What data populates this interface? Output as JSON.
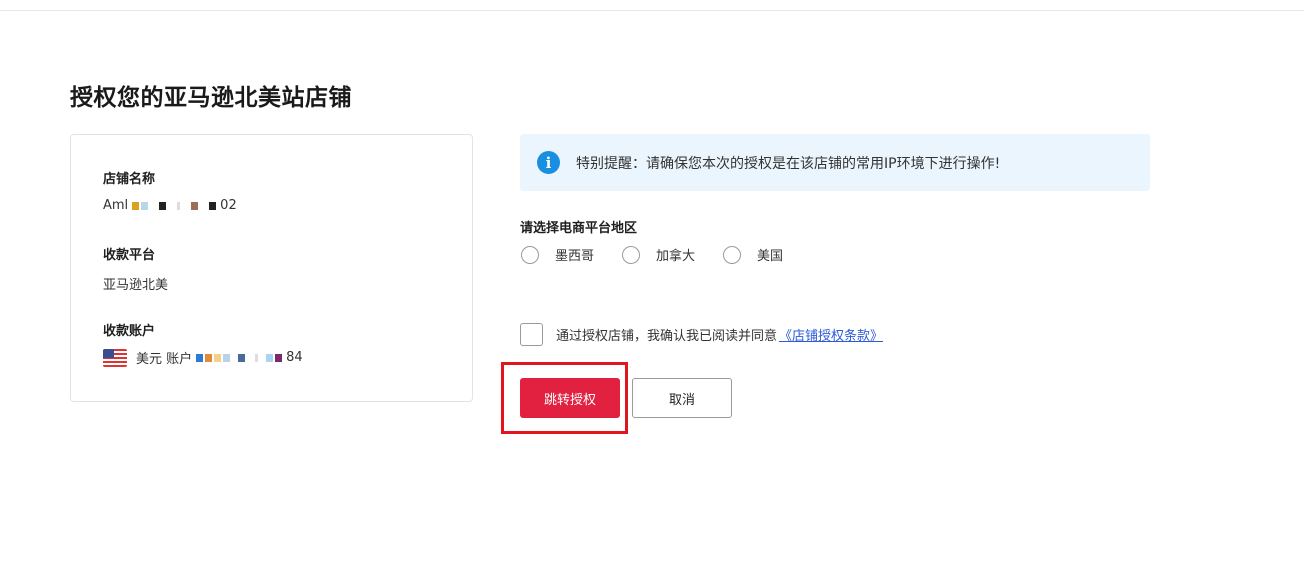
{
  "page": {
    "title": "授权您的亚马逊北美站店铺"
  },
  "store_info": {
    "store_name_label": "店铺名称",
    "store_name_prefix": "Aml",
    "store_name_suffix": "02",
    "platform_label": "收款平台",
    "platform_value": "亚马逊北美",
    "account_label": "收款账户",
    "account_currency": "美元 账户",
    "account_suffix": "84",
    "flag_icon": "us-flag-icon"
  },
  "notice": {
    "icon": "info-icon",
    "text": "特别提醒：请确保您本次的授权是在该店铺的常用IP环境下进行操作!"
  },
  "region": {
    "label": "请选择电商平台地区",
    "options": [
      "墨西哥",
      "加拿大",
      "美国"
    ]
  },
  "agreement": {
    "text": "通过授权店铺，我确认我已阅读并同意",
    "link": "《店铺授权条款》"
  },
  "buttons": {
    "confirm": "跳转授权",
    "cancel": "取消"
  },
  "colors": {
    "primary": "#e2203f",
    "highlight": "#e2141e",
    "notice_bg": "#eaf5fd",
    "info_icon": "#1a8ee1",
    "link": "#2d5bd7"
  }
}
